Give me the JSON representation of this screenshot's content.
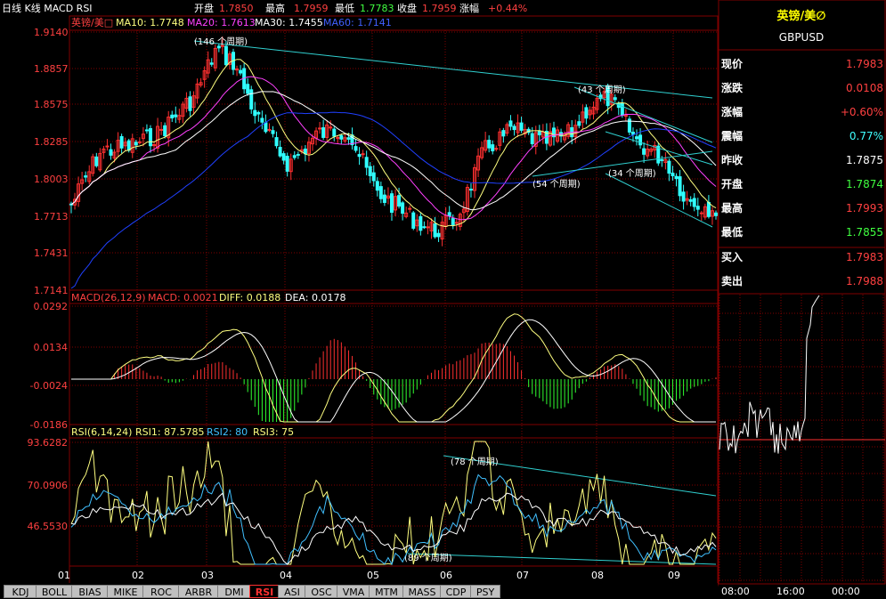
{
  "header": {
    "title": "日线 K线 MACD RSI",
    "open_label": "开盘",
    "open_value": "1.7850",
    "high_label": "最高",
    "high_value": "1.7959",
    "low_label": "最低",
    "low_value": "1.7783",
    "close_label": "收盘",
    "close_value": "1.7959",
    "change_label": "涨幅",
    "change_value": "+0.44%"
  },
  "main_legend": {
    "symbol": "英镑/美□",
    "ma10": "MA10: 1.7748",
    "ma20": "MA20: 1.7613",
    "ma30": "MA30: 1.7455",
    "ma60": "MA60: 1.7141"
  },
  "main_axis": [
    "1.9140",
    "1.8857",
    "1.8575",
    "1.8285",
    "1.8003",
    "1.7713",
    "1.7431",
    "1.7141"
  ],
  "main_annotations": [
    "(146 个周期)",
    "(43 个周期)",
    "(54 个周期)",
    "(34 个周期)"
  ],
  "macd_legend": {
    "name": "MACD(26,12,9)",
    "macd": "MACD: 0.0021",
    "diff": "DIFF: 0.0188",
    "dea": "DEA: 0.0178"
  },
  "macd_axis": [
    "0.0292",
    "0.0134",
    "-0.0024",
    "-0.0186"
  ],
  "rsi_legend": {
    "name": "RSI(6,14,24)",
    "rsi1": "RSI1: 87.5785",
    "rsi2": "RSI2: 80",
    "rsi3": "RSI3: 75"
  },
  "rsi_axis": [
    "93.6282",
    "70.0906",
    "46.5530"
  ],
  "rsi_annotations": [
    "(78 个周期)",
    "(89 个周期)"
  ],
  "x_months": [
    "01",
    "02",
    "03",
    "04",
    "05",
    "06",
    "07",
    "08",
    "09"
  ],
  "tabs": [
    "KDJ",
    "BOLL",
    "BIAS",
    "MIKE",
    "ROC",
    "ARBR",
    "DMI",
    "RSI",
    "ASI",
    "OSC",
    "VMA",
    "MTM",
    "MASS",
    "CDP",
    "PSY"
  ],
  "active_tab": "RSI",
  "quote": {
    "name": "英镑/美∅",
    "code": "GBPUSD",
    "rows": [
      {
        "label": "现价",
        "value": "1.7983",
        "color": "#ff4040"
      },
      {
        "label": "涨跌",
        "value": "0.0108",
        "color": "#ff4040"
      },
      {
        "label": "涨幅",
        "value": "+0.60%",
        "color": "#ff4040"
      },
      {
        "label": "震幅",
        "value": "0.77%",
        "color": "#40ffff"
      },
      {
        "label": "昨收",
        "value": "1.7875",
        "color": "#ffffff"
      },
      {
        "label": "开盘",
        "value": "1.7874",
        "color": "#40ff40"
      },
      {
        "label": "最高",
        "value": "1.7993",
        "color": "#ff4040"
      },
      {
        "label": "最低",
        "value": "1.7855",
        "color": "#40ff40"
      }
    ],
    "bid_label": "买入",
    "bid_value": "1.7983",
    "ask_label": "卖出",
    "ask_value": "1.7988"
  },
  "intraday_times": [
    "08:00",
    "16:00",
    "00:00"
  ],
  "colors": {
    "up": "#ff3030",
    "down": "#30ffff",
    "ma10": "#ffff80",
    "ma20": "#ff40ff",
    "ma30": "#ffffff",
    "ma60": "#2040ff",
    "trend": "#30d0d0",
    "grid": "#800000"
  }
}
